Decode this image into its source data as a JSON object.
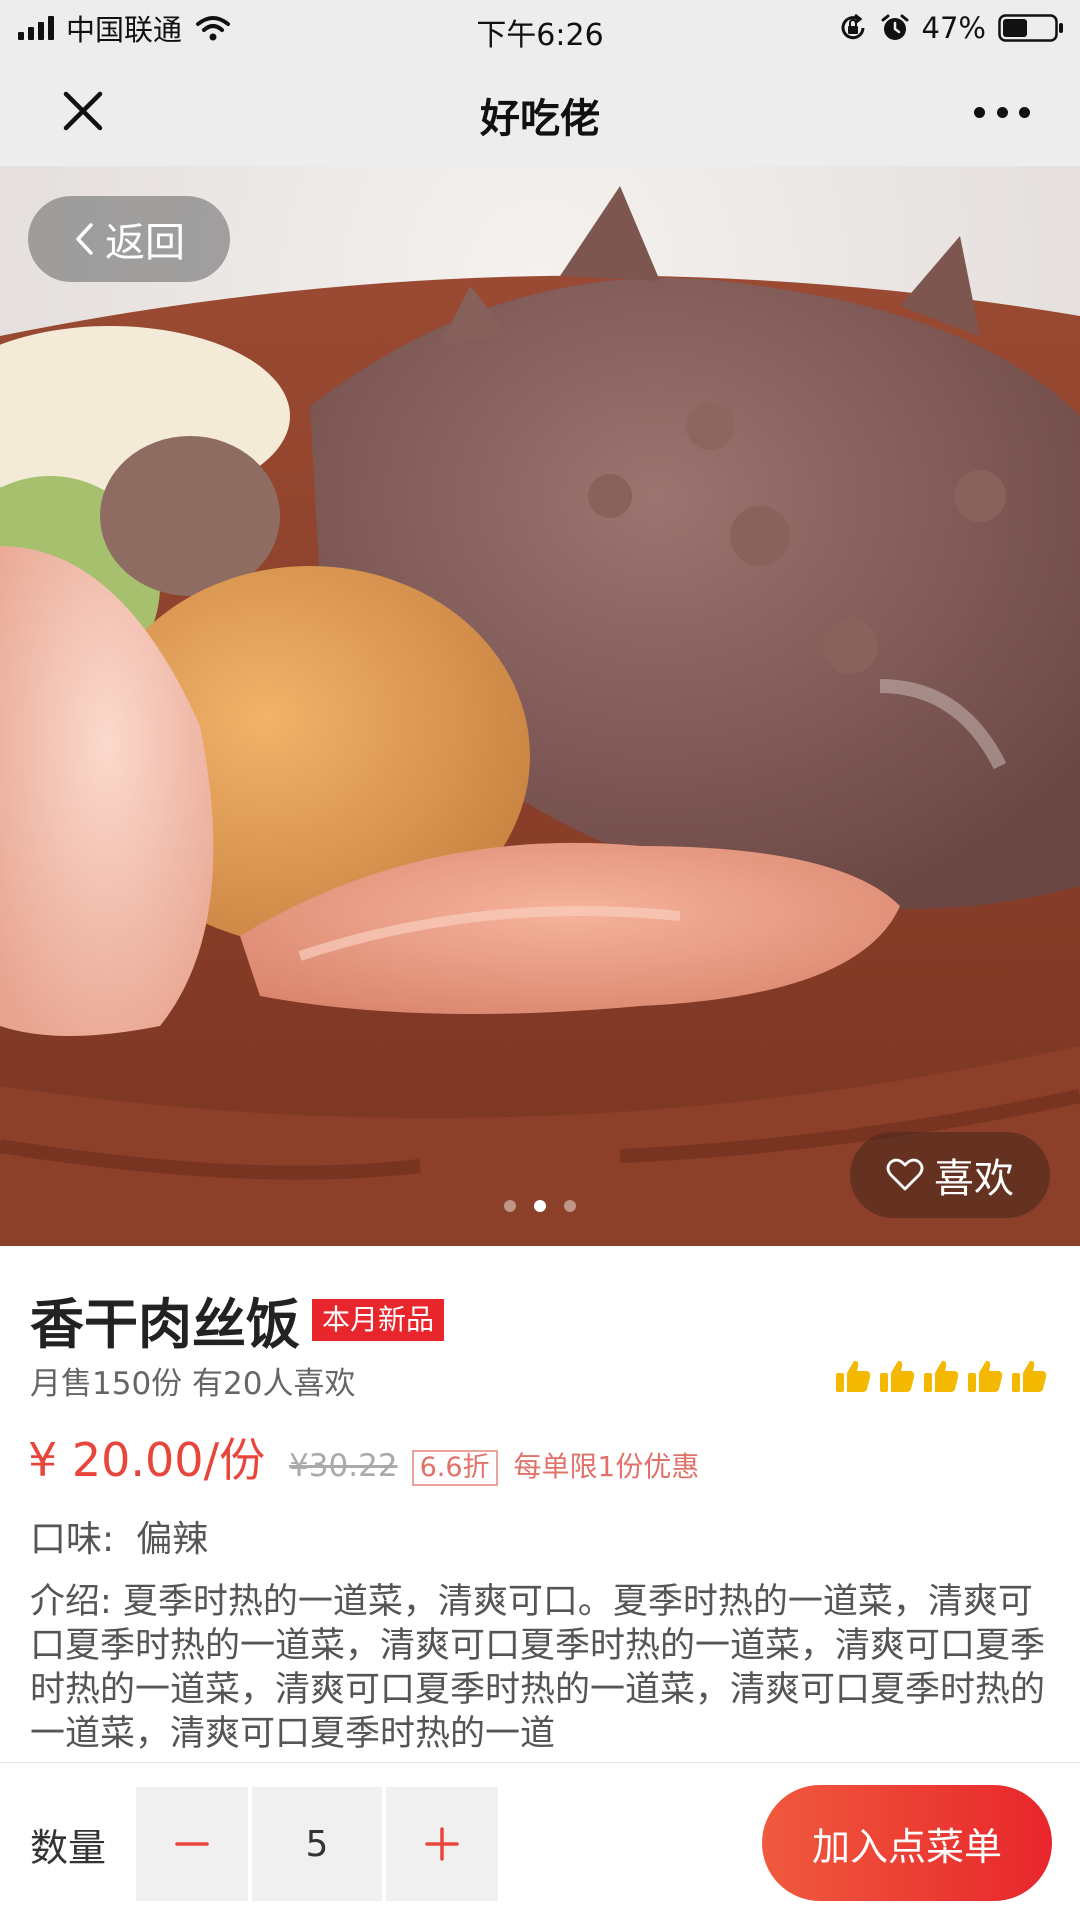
{
  "status_bar": {
    "carrier": "中国联通",
    "time": "下午6:26",
    "battery_percent": "47%",
    "battery_level": 0.47,
    "icons": [
      "signal-icon",
      "wifi-icon",
      "rotation-lock-icon",
      "alarm-icon",
      "battery-icon"
    ]
  },
  "nav": {
    "title": "好吃佬",
    "close_icon": "close-icon",
    "more_icon": "more-icon"
  },
  "gallery": {
    "back_label": "返回",
    "like_label": "喜欢",
    "page_count": 3,
    "active_index": 1
  },
  "product": {
    "name": "香干肉丝饭",
    "badge": "本月新品",
    "sales_text": "月售150份  有20人喜欢",
    "rating": 5,
    "price": "¥ 20.00/份",
    "original_price": "¥30.22",
    "discount": "6.6折",
    "limit_text": "每单限1份优惠",
    "taste_label": "口味:",
    "taste_value": "偏辣",
    "intro_text": "介绍:  夏季时热的一道菜，清爽可口。夏季时热的一道菜，清爽可口夏季时热的一道菜，清爽可口夏季时热的一道菜，清爽可口夏季时热的一道菜，清爽可口夏季时热的一道菜，清爽可口夏季时热的一道菜，清爽可口夏季时热的一道"
  },
  "cart": {
    "quantity_label": "数量",
    "quantity": "5",
    "add_button": "加入点菜单"
  },
  "colors": {
    "accent": "#e8262b",
    "price": "#e8453c",
    "star": "#f5b800"
  }
}
